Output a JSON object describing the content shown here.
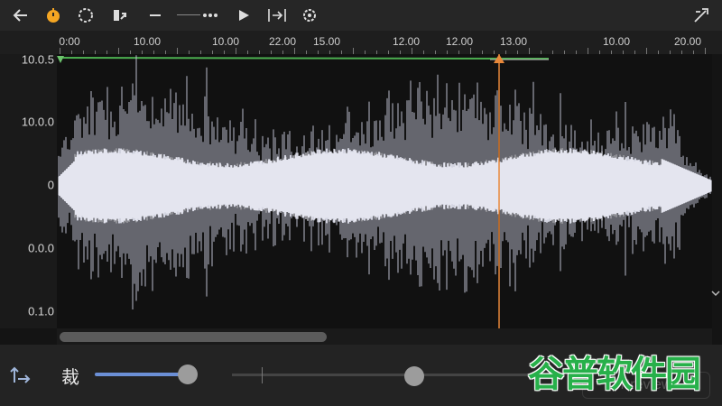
{
  "toolbar": {
    "icons": [
      "back-arrow-icon",
      "timer-icon",
      "loop-icon",
      "export-icon",
      "minus-icon",
      "dash-icon",
      "more-icon",
      "play-icon",
      "jump-icon",
      "settings-icon",
      "effects-icon"
    ]
  },
  "ruler": {
    "labels": [
      "0:00",
      "10.00",
      "10.00",
      "22.00",
      "15.00",
      "12.00",
      "12.00",
      "13.00",
      "10.00",
      "20.00"
    ]
  },
  "yaxis": {
    "labels": [
      "10.0.5",
      "10.0.0",
      "0",
      "0.0.0",
      "0.1.0"
    ]
  },
  "bottom": {
    "slider_label": "裁",
    "slider_value": 0.21,
    "knob2_value": 0.72,
    "preview_label": "Preview"
  },
  "watermark": "谷普软件园",
  "colors": {
    "playhead": "#e8883a",
    "waveform": "#dcdde8",
    "active_track": "#6b8fd6",
    "green_line": "#4caf50",
    "watermark": "#27b04a"
  }
}
